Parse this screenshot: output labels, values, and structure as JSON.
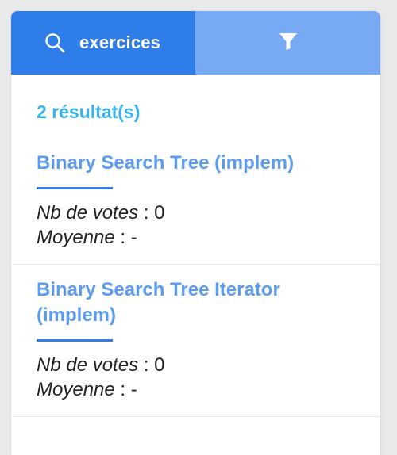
{
  "header": {
    "search_query": "exercices",
    "search_icon": "search-icon",
    "filter_icon": "filter-icon"
  },
  "results": {
    "count_label": "2 résultat(s)",
    "items": [
      {
        "title": "Binary Search Tree (implem)",
        "votes_label": "Nb de votes",
        "votes_value": ": 0",
        "average_label": "Moyenne",
        "average_value": ": -"
      },
      {
        "title": "Binary Search Tree Iterator (implem)",
        "votes_label": "Nb de votes",
        "votes_value": ": 0",
        "average_label": "Moyenne",
        "average_value": ": -"
      }
    ]
  },
  "colors": {
    "primary": "#2f7de8",
    "filter_tab": "#78aaf4",
    "count_text": "#38b4ec",
    "title_text": "#5b9bf0"
  }
}
